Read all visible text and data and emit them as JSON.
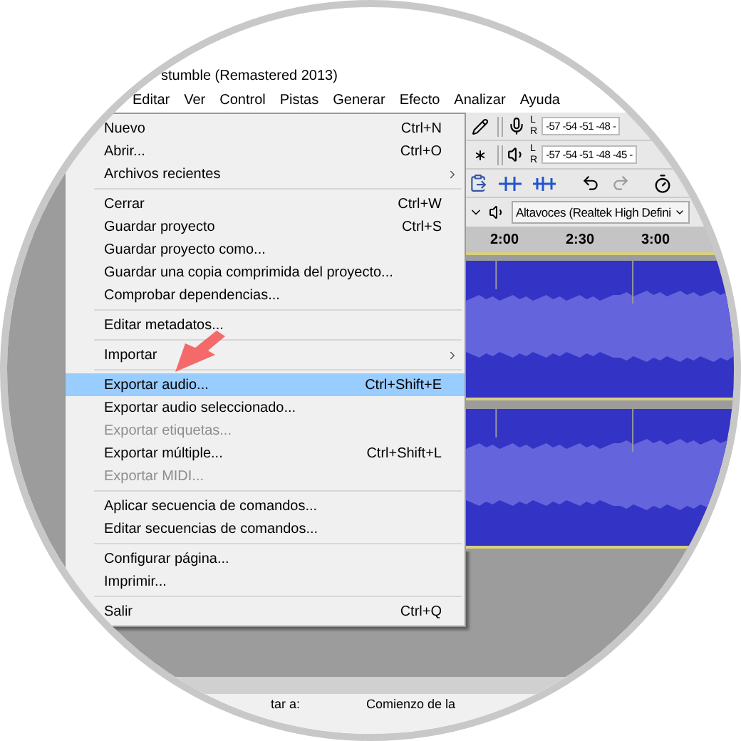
{
  "window": {
    "title": "stumble (Remastered 2013)"
  },
  "menubar": [
    "Editar",
    "Ver",
    "Control",
    "Pistas",
    "Generar",
    "Efecto",
    "Analizar",
    "Ayuda"
  ],
  "file_menu": [
    {
      "kind": "item",
      "label": "Nuevo",
      "shortcut": "Ctrl+N",
      "submenu": false,
      "disabled": false,
      "selected": false
    },
    {
      "kind": "item",
      "label": "Abrir...",
      "shortcut": "Ctrl+O",
      "submenu": false,
      "disabled": false,
      "selected": false
    },
    {
      "kind": "item",
      "label": "Archivos recientes",
      "submenu": true,
      "disabled": false,
      "selected": false
    },
    {
      "kind": "separator"
    },
    {
      "kind": "item",
      "label": "Cerrar",
      "shortcut": "Ctrl+W",
      "submenu": false,
      "disabled": false,
      "selected": false
    },
    {
      "kind": "item",
      "label": "Guardar proyecto",
      "shortcut": "Ctrl+S",
      "submenu": false,
      "disabled": false,
      "selected": false
    },
    {
      "kind": "item",
      "label": "Guardar proyecto como...",
      "submenu": false,
      "disabled": false,
      "selected": false
    },
    {
      "kind": "item",
      "label": "Guardar una copia comprimida del proyecto...",
      "submenu": false,
      "disabled": false,
      "selected": false
    },
    {
      "kind": "item",
      "label": "Comprobar dependencias...",
      "submenu": false,
      "disabled": false,
      "selected": false
    },
    {
      "kind": "separator"
    },
    {
      "kind": "item",
      "label": "Editar metadatos...",
      "submenu": false,
      "disabled": false,
      "selected": false
    },
    {
      "kind": "separator"
    },
    {
      "kind": "item",
      "label": "Importar",
      "submenu": true,
      "disabled": false,
      "selected": false
    },
    {
      "kind": "separator"
    },
    {
      "kind": "item",
      "label": "Exportar audio...",
      "shortcut": "Ctrl+Shift+E",
      "submenu": false,
      "disabled": false,
      "selected": true
    },
    {
      "kind": "item",
      "label": "Exportar audio seleccionado...",
      "submenu": false,
      "disabled": false,
      "selected": false
    },
    {
      "kind": "item",
      "label": "Exportar etiquetas...",
      "submenu": false,
      "disabled": true,
      "selected": false
    },
    {
      "kind": "item",
      "label": "Exportar múltiple...",
      "shortcut": "Ctrl+Shift+L",
      "submenu": false,
      "disabled": false,
      "selected": false
    },
    {
      "kind": "item",
      "label": "Exportar MIDI...",
      "submenu": false,
      "disabled": true,
      "selected": false
    },
    {
      "kind": "separator"
    },
    {
      "kind": "item",
      "label": "Aplicar secuencia de comandos...",
      "submenu": false,
      "disabled": false,
      "selected": false
    },
    {
      "kind": "item",
      "label": "Editar secuencias de comandos...",
      "submenu": false,
      "disabled": false,
      "selected": false
    },
    {
      "kind": "separator"
    },
    {
      "kind": "item",
      "label": "Configurar página...",
      "submenu": false,
      "disabled": false,
      "selected": false
    },
    {
      "kind": "item",
      "label": "Imprimir...",
      "submenu": false,
      "disabled": false,
      "selected": false
    },
    {
      "kind": "separator"
    },
    {
      "kind": "item",
      "label": "Salir",
      "shortcut": "Ctrl+Q",
      "submenu": false,
      "disabled": false,
      "selected": false
    }
  ],
  "meters": [
    {
      "kind": "record",
      "channels": [
        "L",
        "R"
      ],
      "scale": "-57 -54 -51 -48 -"
    },
    {
      "kind": "play",
      "channels": [
        "L",
        "R"
      ],
      "scale": "-57 -54 -51 -48 -45 -"
    }
  ],
  "output_device": "Altavoces (Realtek High Defini",
  "timeline": [
    "2:00",
    "2:30",
    "3:00"
  ],
  "status_bar": [
    "tar a:",
    "Comienzo de la"
  ]
}
